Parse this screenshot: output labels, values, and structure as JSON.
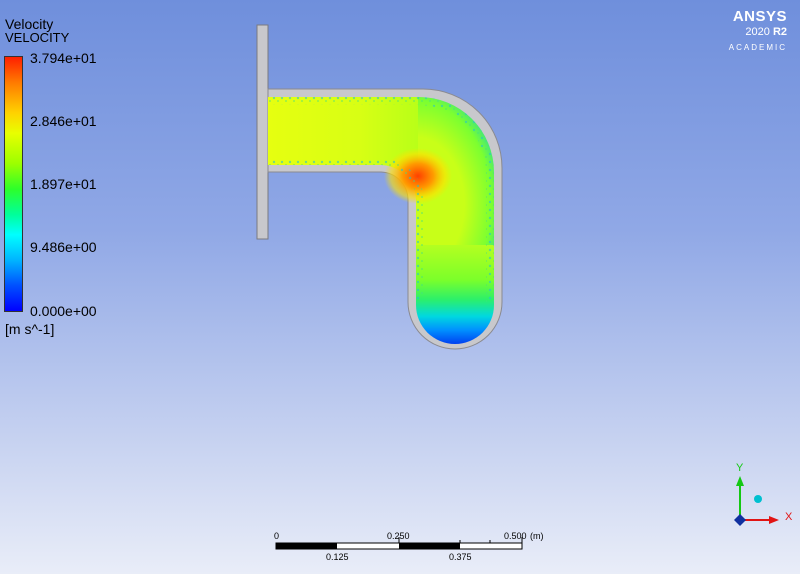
{
  "legend": {
    "title": "Velocity",
    "variable": "VELOCITY",
    "ticks": [
      "3.794e+01",
      "2.846e+01",
      "1.897e+01",
      "9.486e+00",
      "0.000e+00"
    ],
    "unit": "[m s^-1]"
  },
  "brand": {
    "name": "ANSYS",
    "version": "2020",
    "release": "R2",
    "edition": "ACADEMIC"
  },
  "axes": {
    "y_label": "Y",
    "x_label": "X",
    "x_color": "#e11414",
    "y_color": "#14c814",
    "z_color": "#00b8c8"
  },
  "scale_bar": {
    "top_labels": [
      "0",
      "0.250",
      "0.500"
    ],
    "unit": "(m)",
    "bottom_labels": [
      "0.125",
      "0.375"
    ]
  }
}
